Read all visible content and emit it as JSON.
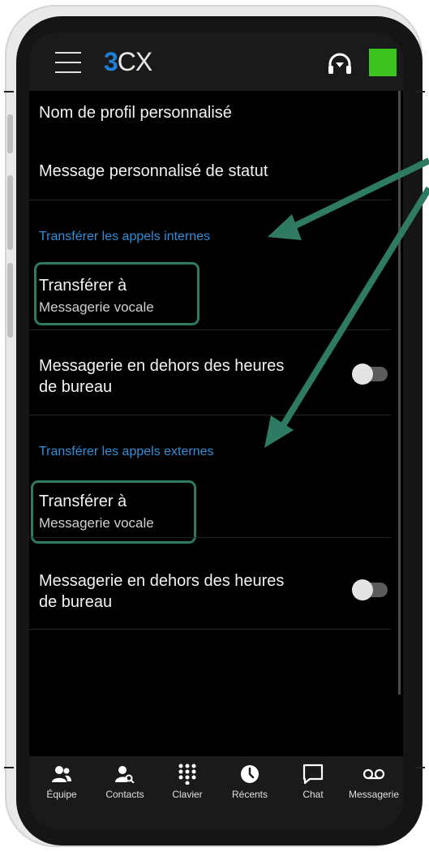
{
  "app": {
    "logo_text": "3CX",
    "logo_number": "3",
    "logo_letters": "CX",
    "status_color": "#3cc31f",
    "accent_color": "#2f8fd8",
    "highlight_color": "#2f7a63"
  },
  "settings": {
    "profile_name_label": "Nom de profil personnalisé",
    "status_message_label": "Message personnalisé de statut",
    "internal": {
      "section_title": "Transférer les appels internes",
      "forward_label": "Transférer à",
      "forward_value": "Messagerie vocale",
      "after_hours_line1": "Messagerie en dehors des heures",
      "after_hours_line2": "de bureau",
      "after_hours_enabled": false
    },
    "external": {
      "section_title": "Transférer les appels externes",
      "forward_label": "Transférer à",
      "forward_value": "Messagerie vocale",
      "after_hours_line1": "Messagerie en dehors des heures",
      "after_hours_line2": "de bureau",
      "after_hours_enabled": false
    }
  },
  "bottom_nav": [
    {
      "label": "Équipe",
      "icon": "team-icon"
    },
    {
      "label": "Contacts",
      "icon": "contacts-search-icon"
    },
    {
      "label": "Clavier",
      "icon": "dialpad-icon"
    },
    {
      "label": "Récents",
      "icon": "clock-icon"
    },
    {
      "label": "Chat",
      "icon": "chat-icon"
    },
    {
      "label": "Messagerie",
      "icon": "voicemail-icon"
    }
  ]
}
